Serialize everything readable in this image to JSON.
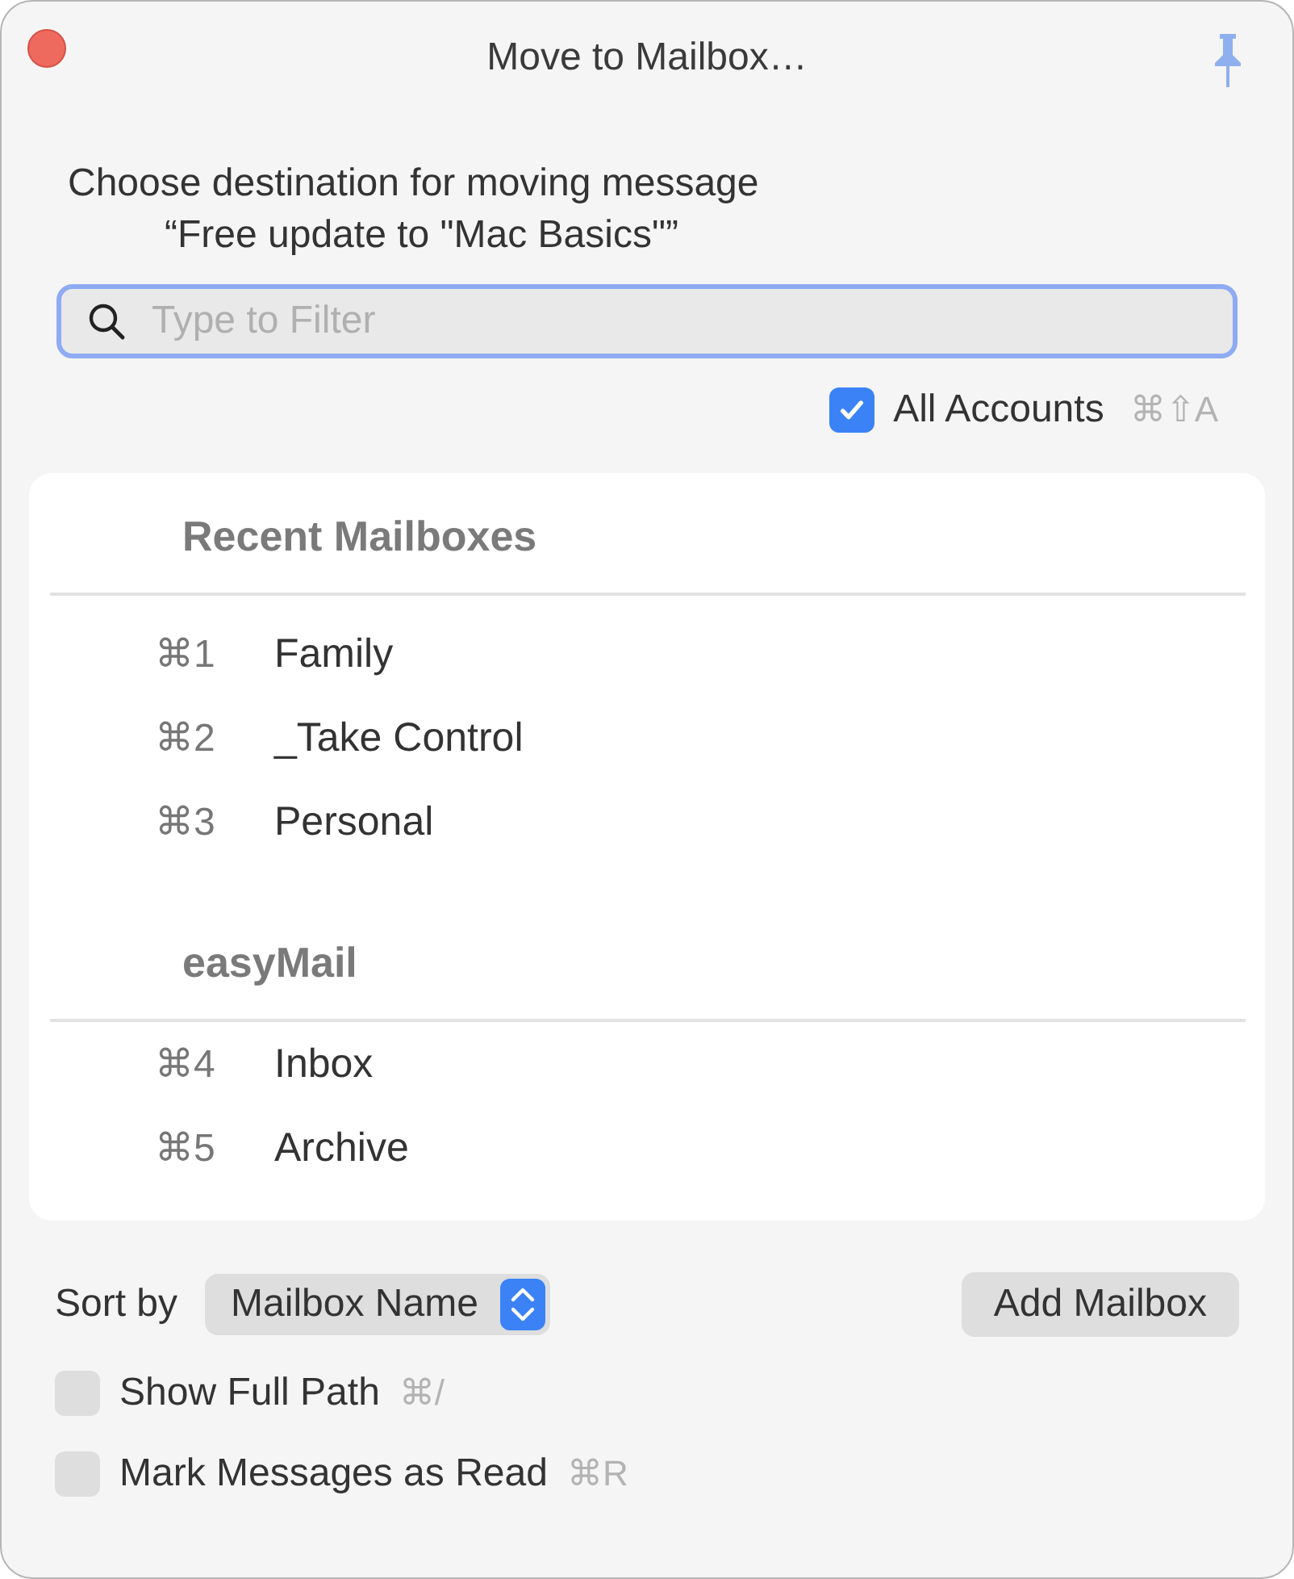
{
  "window": {
    "title": "Move to Mailbox…"
  },
  "prompt": [
    "Choose destination for moving message",
    "“Free update to \"Mac Basics\"”"
  ],
  "filter": {
    "placeholder": "Type to Filter"
  },
  "all_accounts": {
    "label": "All Accounts",
    "shortcut": "⌘⇧A",
    "checked": true
  },
  "sections": [
    {
      "title": "Recent Mailboxes",
      "items": [
        {
          "shortcut": "⌘1",
          "name": "Family"
        },
        {
          "shortcut": "⌘2",
          "name": "_Take Control"
        },
        {
          "shortcut": "⌘3",
          "name": "Personal"
        }
      ]
    },
    {
      "title": "easyMail",
      "items": [
        {
          "shortcut": "⌘4",
          "name": "Inbox"
        },
        {
          "shortcut": "⌘5",
          "name": "Archive"
        }
      ]
    }
  ],
  "sort": {
    "label": "Sort by",
    "value": "Mailbox Name"
  },
  "add_button": "Add Mailbox",
  "options": [
    {
      "label": "Show Full Path",
      "shortcut": "⌘/",
      "checked": false
    },
    {
      "label": "Mark Messages as Read",
      "shortcut": "⌘R",
      "checked": false
    }
  ]
}
